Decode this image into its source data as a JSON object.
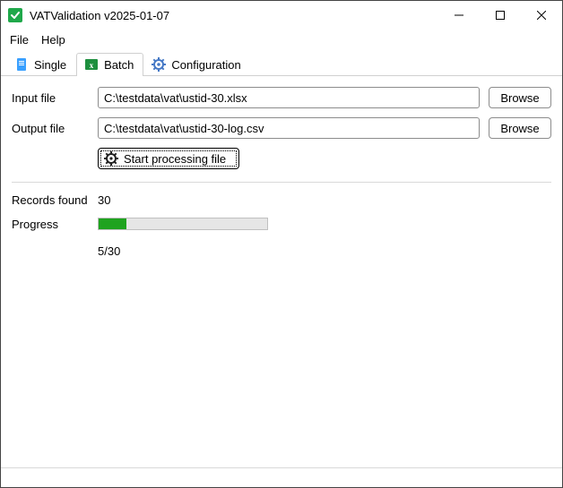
{
  "window": {
    "title": "VATValidation v2025-01-07"
  },
  "menu": {
    "file": "File",
    "help": "Help"
  },
  "tabs": {
    "single": "Single",
    "batch": "Batch",
    "configuration": "Configuration"
  },
  "form": {
    "input_label": "Input file",
    "input_value": "C:\\testdata\\vat\\ustid-30.xlsx",
    "output_label": "Output file",
    "output_value": "C:\\testdata\\vat\\ustid-30-log.csv",
    "browse": "Browse",
    "start": "Start processing file"
  },
  "status": {
    "records_label": "Records found",
    "records_value": "30",
    "progress_label": "Progress",
    "progress_done": 5,
    "progress_total": 30,
    "progress_text": "5/30"
  },
  "colors": {
    "progress_fill": "#1fa31f",
    "accent": "#1fa84a"
  }
}
